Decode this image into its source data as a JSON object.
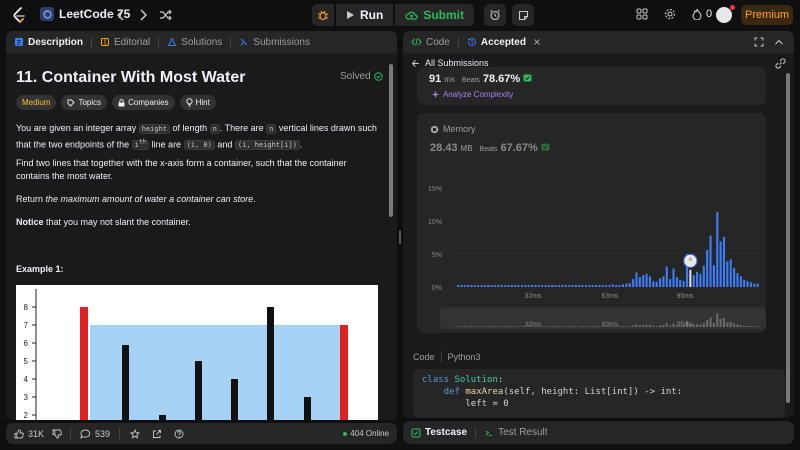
{
  "topbar": {
    "problem_list": "LeetCode 75",
    "run_label": "Run",
    "submit_label": "Submit",
    "streak_count": "0",
    "premium_label": "Premium"
  },
  "left_tabs": [
    "Description",
    "Editorial",
    "Solutions",
    "Submissions"
  ],
  "problem": {
    "title": "11. Container With Most Water",
    "status": "Solved",
    "difficulty": "Medium",
    "chip_topics": "Topics",
    "chip_companies": "Companies",
    "chip_hint": "Hint",
    "p1_a": "You are given an integer array ",
    "p1_code1": "height",
    "p1_b": " of length ",
    "p1_code2": "n",
    "p1_c": ". There are ",
    "p1_code3": "n",
    "p1_d": " vertical lines drawn such that the two endpoints of the ",
    "p1_code4": "i",
    "p1_sup": "th",
    "p1_e": " line are ",
    "p1_code5": "(i, 0)",
    "p1_f": " and ",
    "p1_code6": "(i, height[i])",
    "p1_g": ".",
    "p2": "Find two lines that together with the x-axis form a container, such that the container contains the most water.",
    "p3_a": "Return ",
    "p3_em": "the maximum amount of water a container can store",
    "p3_b": ".",
    "p4_strong": "Notice",
    "p4_rest": " that you may not slant the container.",
    "example_title": "Example 1:",
    "example_y_ticks": [
      "8",
      "7",
      "6",
      "5",
      "4",
      "3",
      "2"
    ]
  },
  "left_footer": {
    "likes": "31K",
    "comments": "539",
    "online": "404 Online"
  },
  "right_tabs": {
    "code": "Code",
    "accepted": "Accepted"
  },
  "submission": {
    "all_submissions": "All Submissions",
    "runtime_value": "91",
    "runtime_unit": "ms",
    "beats_label": "Beats",
    "runtime_beats": "78.67%",
    "analyze": "Analyze Complexity",
    "memory_label": "Memory",
    "memory_value": "28.43",
    "memory_unit": "MB",
    "memory_beats": "67.67%"
  },
  "chart_data": {
    "type": "bar",
    "y_ticks": [
      "15%",
      "10%",
      "5%",
      "0%"
    ],
    "x_ticks": [
      "32ms",
      "63ms",
      "95ms"
    ],
    "mini_x_ticks": [
      "32ms",
      "63ms",
      "95ms"
    ],
    "ylim": [
      0,
      15
    ],
    "values": [
      0.3,
      0.3,
      0.3,
      0.3,
      0.3,
      0.3,
      0.3,
      0.3,
      0.3,
      0.3,
      0.3,
      0.3,
      0.3,
      0.3,
      0.3,
      0.3,
      0.3,
      0.3,
      0.3,
      0.3,
      0.3,
      0.3,
      0.3,
      0.3,
      0.3,
      0.3,
      0.3,
      0.3,
      0.3,
      0.3,
      0.3,
      0.3,
      0.3,
      0.3,
      0.3,
      0.3,
      0.3,
      0.3,
      0.3,
      0.3,
      0.3,
      0.3,
      0.3,
      0.3,
      0.3,
      0.3,
      0.4,
      0.3,
      0.3,
      0.4,
      0.5,
      0.6,
      1.2,
      2.2,
      1.5,
      1.8,
      2.0,
      1.6,
      0.9,
      0.8,
      1.3,
      1.6,
      3.1,
      1.2,
      2.8,
      1.5,
      1.1,
      0.9,
      5.0,
      2.6,
      1.8,
      2.3,
      2.0,
      3.2,
      5.6,
      7.8,
      3.3,
      11.4,
      6.9,
      7.6,
      3.9,
      4.2,
      2.9,
      2.1,
      1.6,
      1.1,
      0.9,
      0.7,
      0.5,
      0.5
    ],
    "highlight_index": 69,
    "bar_color": "#3d7dfa",
    "highlight_color": "#d8e3ff"
  },
  "code_section": {
    "label": "Code",
    "language": "Python3",
    "lines": [
      {
        "kw": "class",
        "name": " Solution",
        "rest": ":"
      },
      {
        "indent": "    ",
        "kw": "def",
        "name": " maxArea",
        "rest": "(self, height: List[int]) -> int:"
      },
      {
        "indent": "        ",
        "text": "left = 0"
      }
    ]
  },
  "right_footer": {
    "testcase": "Testcase",
    "test_result": "Test Result"
  }
}
